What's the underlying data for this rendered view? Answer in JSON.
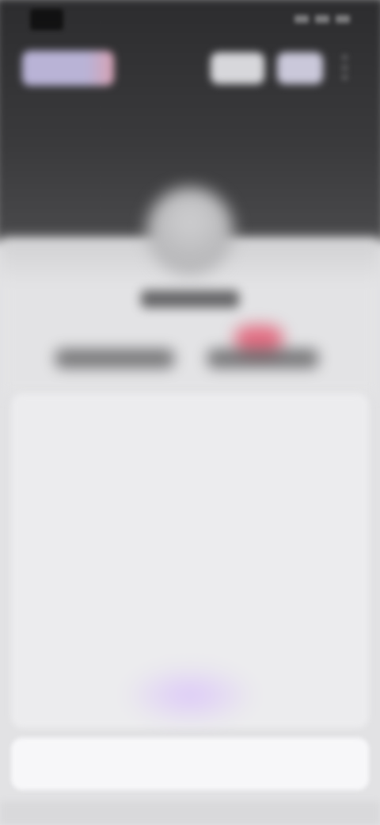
{
  "status_bar": {
    "time": "",
    "icons": [
      "signal-icon",
      "wifi-icon",
      "battery-icon"
    ]
  },
  "header": {
    "chip_label": "",
    "right_buttons": [
      "",
      ""
    ]
  },
  "profile": {
    "username": "",
    "stats": [
      "",
      ""
    ]
  },
  "action_sheet": {
    "items": [
      "",
      "",
      "",
      "",
      "",
      ""
    ],
    "cancel_label": ""
  },
  "colors": {
    "accent": "#3d7de0",
    "highlight": "#8a5ee6",
    "badge": "#e25a72",
    "hero": "#2c2c2e"
  }
}
